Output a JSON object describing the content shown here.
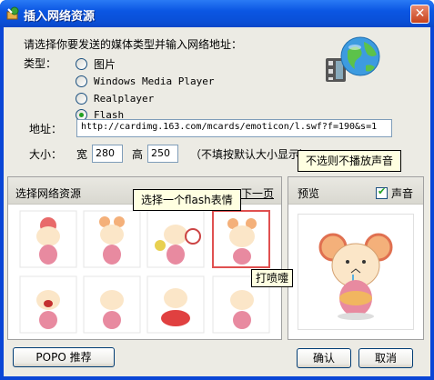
{
  "window": {
    "title": "插入网络资源",
    "close_symbol": "✕"
  },
  "form": {
    "prompt": "请选择你要发送的媒体类型并输入网络地址：",
    "type_label": "类型：",
    "types": [
      {
        "label": "图片",
        "checked": false
      },
      {
        "label": "Windows Media Player",
        "checked": false
      },
      {
        "label": "Realplayer",
        "checked": false
      },
      {
        "label": "Flash",
        "checked": true
      }
    ],
    "address_label": "地址：",
    "address_value": "http://cardimg.163.com/mcards/emoticon/l.swf?f=190&s=1",
    "size_label": "大小：",
    "width_label": "宽",
    "width_value": "280",
    "height_label": "高",
    "height_value": "250",
    "size_note": "（不填按默认大小显示）"
  },
  "tooltips": {
    "no_sound": "不选则不播放声音",
    "select_flash": "选择一个flash表情",
    "item_name": "打喷嚏"
  },
  "resource_panel": {
    "title": "选择网络资源",
    "next_page": "下一页"
  },
  "preview_panel": {
    "title": "预览",
    "sound_label": "声音",
    "sound_checked": true
  },
  "buttons": {
    "popo": "POPO 推荐",
    "ok": "确认",
    "cancel": "取消"
  },
  "icons": {
    "title": "app-icon",
    "globe": "globe-film-icon"
  },
  "colors": {
    "titlebar": "#0a4fd6",
    "accent_selected": "#e05050",
    "check": "#21a121"
  }
}
